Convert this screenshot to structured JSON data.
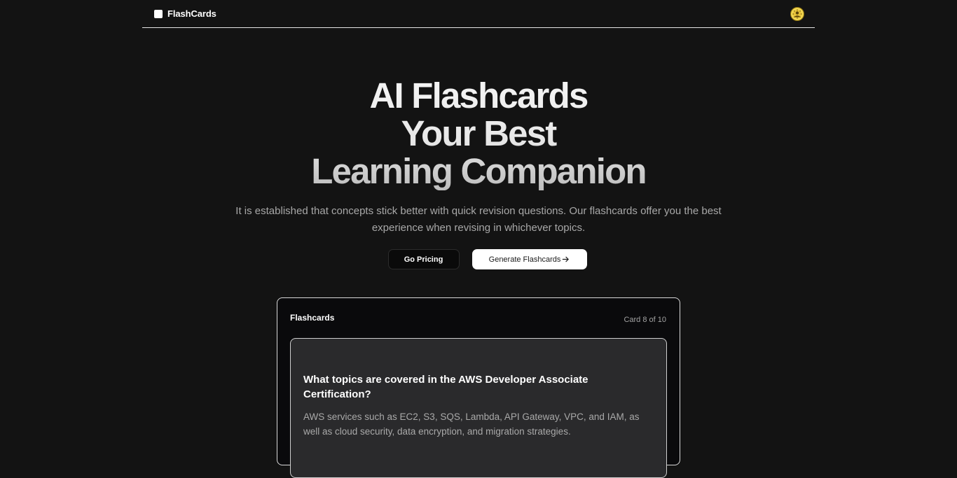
{
  "navbar": {
    "brand_name": "FlashCards",
    "avatar_icon": "user-avatar-icon"
  },
  "hero": {
    "title_lines": [
      "AI Flashcards",
      "Your Best",
      "Learning Companion"
    ],
    "subtitle": "It is established that concepts stick better with quick revision questions. Our flashcards offer you the best experience when revising in whichever topics.",
    "primary_button": "Go Pricing",
    "secondary_button": "Generate Flashcards",
    "secondary_button_icon": "arrow-right-icon"
  },
  "flashcards": {
    "title": "Flashcards",
    "counter": "Card 8 of 10",
    "current_card": {
      "question": "What topics are covered in the AWS Developer Associate Certification?",
      "answer": "AWS services such as EC2, S3, SQS, Lambda, API Gateway, VPC, and IAM, as well as cloud security, data encryption, and migration strategies."
    }
  },
  "colors": {
    "background": "#131313",
    "panel": "#0a0a0c",
    "card": "#2a2a2c",
    "subtitle_text": "#a8a8a8"
  }
}
